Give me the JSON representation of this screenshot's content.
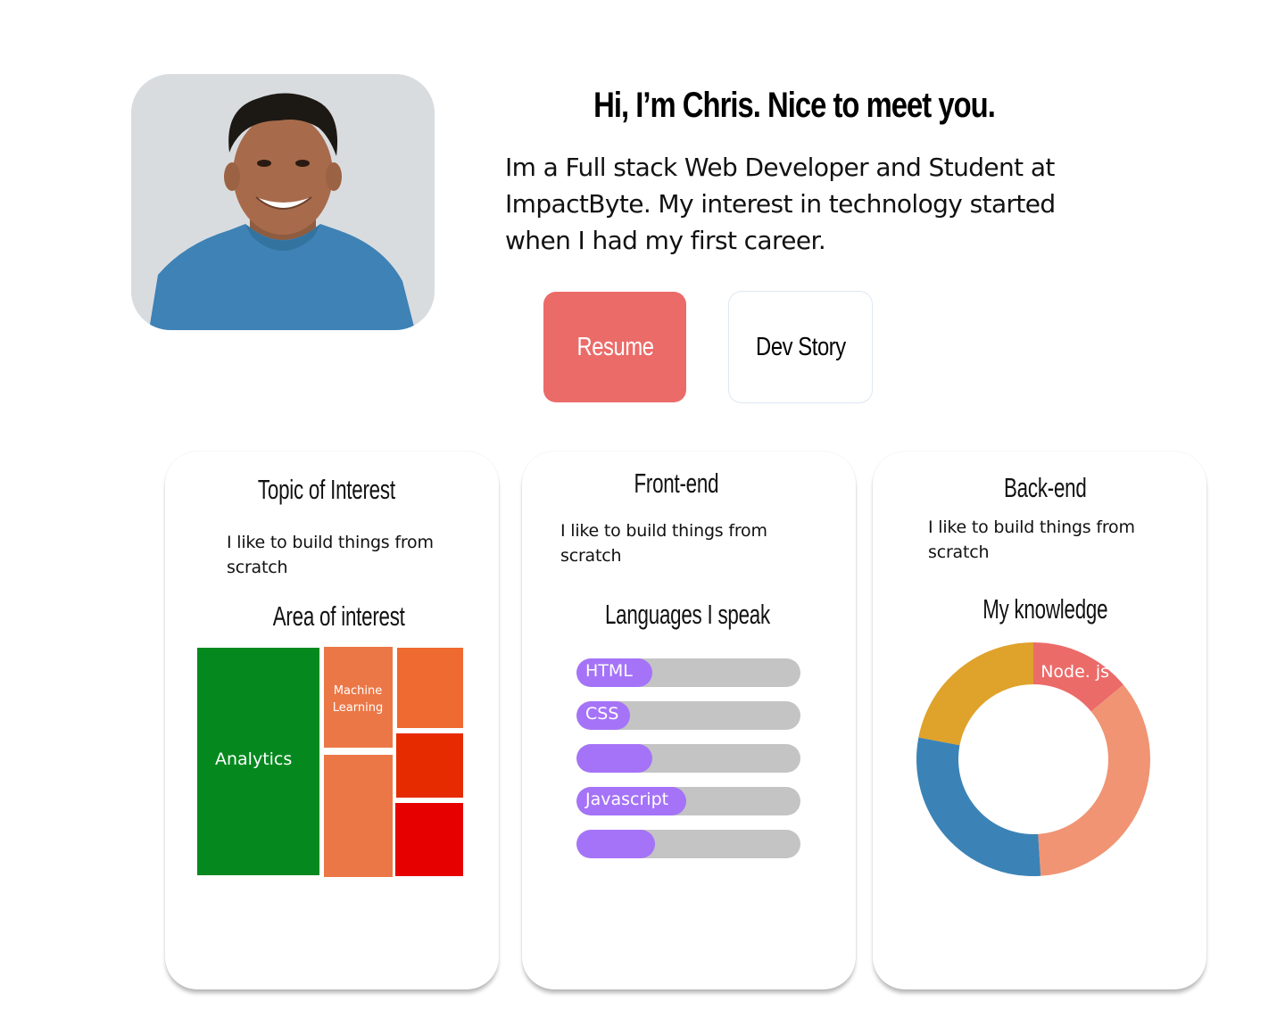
{
  "hero": {
    "title": "Hi, I’m Chris. Nice to meet you.",
    "intro": "Im a Full stack Web Developer and Student at ImpactByte. My interest in technology started when I had my first career.",
    "buttons": {
      "resume": "Resume",
      "dev_story": "Dev Story"
    }
  },
  "cards": [
    {
      "title": "Topic of Interest",
      "text": "I like to build things from scratch",
      "subtitle": "Area of interest"
    },
    {
      "title": "Front-end",
      "text": "I like to build things from scratch",
      "subtitle": "Languages I speak"
    },
    {
      "title": "Back-end",
      "text": "I like to build things from scratch",
      "subtitle": "My knowledge"
    }
  ],
  "treemap": {
    "labels": [
      "Analytics",
      "Machine Learning"
    ],
    "colors": [
      "#05891f",
      "#ec7746",
      "#ec7746",
      "#ef6a30",
      "#e62b00",
      "#e60000"
    ]
  },
  "languages": {
    "fill_color": "#a573f8",
    "track_color": "#c4c4c4",
    "items": [
      {
        "label": "HTML",
        "level": 0.34
      },
      {
        "label": "CSS",
        "level": 0.24
      },
      {
        "label": "",
        "level": 0.34
      },
      {
        "label": "Javascript",
        "level": 0.49
      },
      {
        "label": "",
        "level": 0.35
      }
    ]
  },
  "chart_data": {
    "type": "pie",
    "title": "My knowledge",
    "slices": [
      {
        "label": "Node. js",
        "value": 14,
        "color": "#eb6b69"
      },
      {
        "label": "",
        "value": 35,
        "color": "#f09473"
      },
      {
        "label": "",
        "value": 29,
        "color": "#3b83b6"
      },
      {
        "label": "",
        "value": 22,
        "color": "#dfa22a"
      }
    ]
  }
}
